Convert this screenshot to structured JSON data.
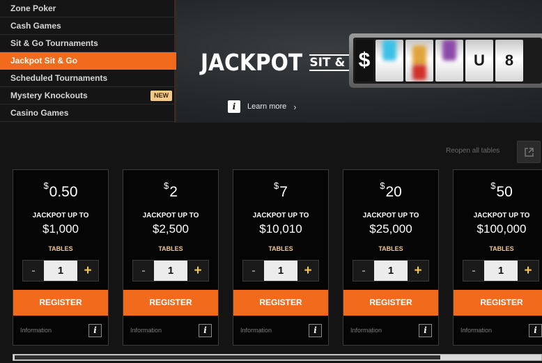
{
  "menu": {
    "items": [
      {
        "label": "Zone Poker"
      },
      {
        "label": "Cash Games"
      },
      {
        "label": "Sit & Go Tournaments"
      },
      {
        "label": "Jackpot Sit & Go",
        "active": true
      },
      {
        "label": "Scheduled Tournaments"
      },
      {
        "label": "Mystery Knockouts",
        "badge": "NEW"
      },
      {
        "label": "Casino Games"
      }
    ]
  },
  "hero": {
    "title": "JACKPOT",
    "subtitle": "SIT & GO",
    "learn_more": "Learn more",
    "info_glyph": "i",
    "slot_reels": [
      "$",
      "",
      "",
      "",
      "U",
      "8"
    ]
  },
  "reopen": {
    "label": "Reopen all tables",
    "icon": "external-link-icon"
  },
  "cards": [
    {
      "currency": "$",
      "buyin": "0.50",
      "jackpot_label": "JACKPOT UP TO",
      "jackpot": "$1,000",
      "tables_label": "TABLES",
      "minus": "-",
      "tables": "1",
      "plus": "+",
      "register": "REGISTER",
      "info_label": "Information",
      "info_glyph": "i"
    },
    {
      "currency": "$",
      "buyin": "2",
      "jackpot_label": "JACKPOT UP TO",
      "jackpot": "$2,500",
      "tables_label": "TABLES",
      "minus": "-",
      "tables": "1",
      "plus": "+",
      "register": "REGISTER",
      "info_label": "Information",
      "info_glyph": "i"
    },
    {
      "currency": "$",
      "buyin": "7",
      "jackpot_label": "JACKPOT UP TO",
      "jackpot": "$10,010",
      "tables_label": "TABLES",
      "minus": "-",
      "tables": "1",
      "plus": "+",
      "register": "REGISTER",
      "info_label": "Information",
      "info_glyph": "i"
    },
    {
      "currency": "$",
      "buyin": "20",
      "jackpot_label": "JACKPOT UP TO",
      "jackpot": "$25,000",
      "tables_label": "TABLES",
      "minus": "-",
      "tables": "1",
      "plus": "+",
      "register": "REGISTER",
      "info_label": "Information",
      "info_glyph": "i"
    },
    {
      "currency": "$",
      "buyin": "50",
      "jackpot_label": "JACKPOT UP TO",
      "jackpot": "$100,000",
      "tables_label": "TABLES",
      "minus": "-",
      "tables": "1",
      "plus": "+",
      "register": "REGISTER",
      "info_label": "Information",
      "info_glyph": "i"
    }
  ],
  "scrollbar": {
    "position": 0.0,
    "visible_fraction": 0.81
  },
  "colors": {
    "accent": "#f26a1b",
    "badge": "#f3c98a",
    "plus": "#f3c64a",
    "background": "#141414"
  }
}
